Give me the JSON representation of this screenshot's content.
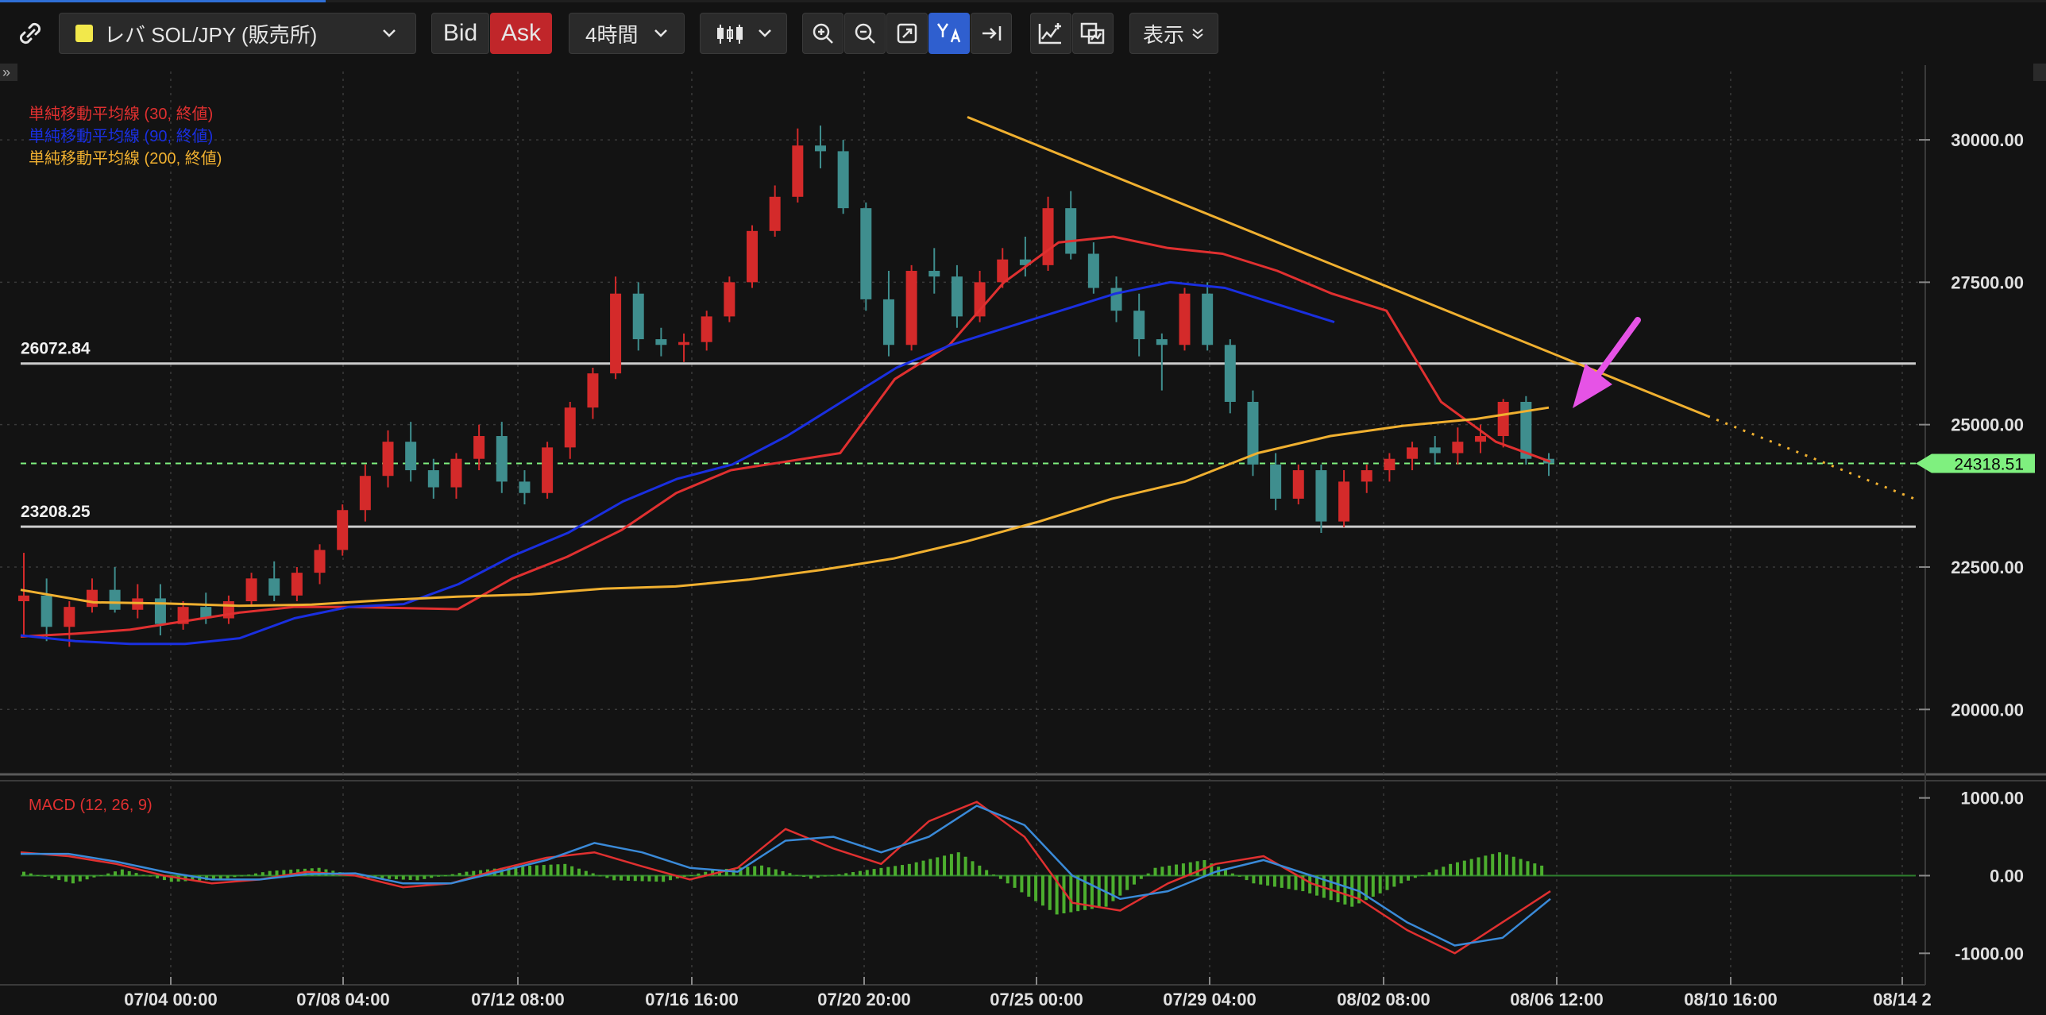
{
  "toolbar": {
    "link_icon": "link-icon",
    "symbol": "レバ SOL/JPY (販売所)",
    "bid_label": "Bid",
    "ask_label": "Ask",
    "timeframe": "4時間",
    "display_label": "表示",
    "colors": {
      "symbol_dot": "#f2e84b",
      "ask": "#c0262a",
      "active": "#2f5fcf"
    }
  },
  "chart_data": [
    {
      "type": "line",
      "subtype": "candlestick",
      "title": "",
      "legend_placement": "top-left",
      "series": [
        {
          "name": "単純移動平均線 (30, 終値)",
          "color": "#e03030",
          "values": [
            21280,
            21330,
            21400,
            21550,
            21700,
            21800,
            21800,
            21780,
            21760,
            22300,
            22680,
            23150,
            23800,
            24200,
            24350,
            24500,
            25800,
            26400,
            27500,
            28200,
            28300,
            28100,
            28000,
            27700,
            27300,
            27000,
            25400,
            24700,
            24350
          ]
        },
        {
          "name": "単純移動平均線 (90, 終値)",
          "color": "#1a2fe0",
          "values": [
            21300,
            21200,
            21150,
            21150,
            21250,
            21600,
            21800,
            21850,
            22200,
            22700,
            23100,
            23650,
            24050,
            24300,
            24800,
            25400,
            26000,
            26400,
            26700,
            27000,
            27300,
            27500,
            27400,
            27100,
            26800
          ]
        },
        {
          "name": "単純移動平均線 (200, 終値)",
          "color": "#f0b030",
          "values": [
            22100,
            21880,
            21860,
            21820,
            21840,
            21920,
            21980,
            22020,
            22120,
            22160,
            22280,
            22450,
            22650,
            22950,
            23300,
            23700,
            24000,
            24500,
            24800,
            24980,
            25100,
            25300
          ]
        }
      ],
      "candles_sample": [
        [
          21900,
          22750,
          21300,
          22000
        ],
        [
          22000,
          22300,
          21200,
          21450
        ],
        [
          21450,
          21900,
          21100,
          21800
        ],
        [
          21800,
          22300,
          21700,
          22100
        ],
        [
          22100,
          22500,
          21700,
          21750
        ],
        [
          21750,
          22200,
          21600,
          21950
        ],
        [
          21950,
          22200,
          21300,
          21500
        ],
        [
          21500,
          21900,
          21400,
          21800
        ],
        [
          21800,
          22050,
          21500,
          21600
        ],
        [
          21600,
          22000,
          21500,
          21900
        ],
        [
          21900,
          22400,
          21800,
          22300
        ],
        [
          22300,
          22600,
          21900,
          22000
        ],
        [
          22000,
          22500,
          21900,
          22400
        ],
        [
          22400,
          22900,
          22200,
          22800
        ],
        [
          22800,
          23600,
          22700,
          23500
        ],
        [
          23500,
          24300,
          23300,
          24100
        ],
        [
          24100,
          24900,
          23900,
          24700
        ],
        [
          24700,
          25050,
          24000,
          24200
        ],
        [
          24200,
          24400,
          23700,
          23900
        ],
        [
          23900,
          24500,
          23700,
          24400
        ],
        [
          24400,
          25000,
          24200,
          24800
        ],
        [
          24800,
          25050,
          23800,
          24000
        ],
        [
          24000,
          24200,
          23600,
          23800
        ],
        [
          23800,
          24700,
          23700,
          24600
        ],
        [
          24600,
          25400,
          24400,
          25300
        ],
        [
          25300,
          26000,
          25100,
          25900
        ],
        [
          25900,
          27600,
          25800,
          27300
        ],
        [
          27300,
          27500,
          26300,
          26500
        ],
        [
          26500,
          26700,
          26200,
          26400
        ],
        [
          26400,
          26600,
          26100,
          26450
        ],
        [
          26450,
          27000,
          26300,
          26900
        ],
        [
          26900,
          27600,
          26800,
          27500
        ],
        [
          27500,
          28500,
          27400,
          28400
        ],
        [
          28400,
          29200,
          28300,
          29000
        ],
        [
          29000,
          30200,
          28900,
          29900
        ],
        [
          29900,
          30250,
          29500,
          29800
        ],
        [
          29800,
          30000,
          28700,
          28800
        ],
        [
          28800,
          28900,
          27000,
          27200
        ],
        [
          27200,
          27700,
          26200,
          26400
        ],
        [
          26400,
          27800,
          26300,
          27700
        ],
        [
          27700,
          28100,
          27300,
          27600
        ],
        [
          27600,
          27800,
          26700,
          26900
        ],
        [
          26900,
          27700,
          26800,
          27500
        ],
        [
          27500,
          28100,
          27400,
          27900
        ],
        [
          27900,
          28300,
          27600,
          27800
        ],
        [
          27800,
          29000,
          27700,
          28800
        ],
        [
          28800,
          29100,
          27900,
          28000
        ],
        [
          28000,
          28200,
          27300,
          27400
        ],
        [
          27400,
          27600,
          26800,
          27000
        ],
        [
          27000,
          27300,
          26200,
          26500
        ],
        [
          26500,
          26600,
          25600,
          26400
        ],
        [
          26400,
          27400,
          26300,
          27300
        ],
        [
          27300,
          27500,
          26300,
          26400
        ],
        [
          26400,
          26500,
          25200,
          25400
        ],
        [
          25400,
          25600,
          24100,
          24300
        ],
        [
          24300,
          24500,
          23500,
          23700
        ],
        [
          23700,
          24300,
          23600,
          24200
        ],
        [
          24200,
          24300,
          23100,
          23300
        ],
        [
          23300,
          24200,
          23200,
          24000
        ],
        [
          24000,
          24300,
          23800,
          24200
        ],
        [
          24200,
          24500,
          24000,
          24400
        ],
        [
          24400,
          24700,
          24200,
          24600
        ],
        [
          24600,
          24800,
          24300,
          24500
        ],
        [
          24500,
          24950,
          24300,
          24700
        ],
        [
          24700,
          25000,
          24500,
          24800
        ],
        [
          24800,
          25450,
          24600,
          25400
        ],
        [
          25400,
          25500,
          24300,
          24400
        ],
        [
          24400,
          24500,
          24100,
          24318.51
        ]
      ],
      "horizontal_lines": [
        {
          "label": "26072.84",
          "value": 26072.84,
          "color": "#cccccc"
        },
        {
          "label": "23208.25",
          "value": 23208.25,
          "color": "#cccccc"
        },
        {
          "label": "24318.51",
          "value": 24318.51,
          "color": "#7ff07f",
          "dashed": true
        }
      ],
      "trendline": {
        "from": [
          "07/22",
          30400
        ],
        "to": [
          "08/14",
          23800
        ],
        "color": "#f0b030"
      },
      "annotation": {
        "type": "arrow",
        "color": "#e653e6",
        "points_to": "trendline break near 25300"
      },
      "y_ticks": [
        "30000.00",
        "27500.00",
        "25000.00",
        "22500.00",
        "20000.00"
      ],
      "ylim": [
        19000,
        31200
      ],
      "grid": true
    },
    {
      "type": "bar",
      "title": "MACD (12, 26, 9)",
      "series": [
        {
          "name": "",
          "color": "#e03030",
          "values": [
            300,
            250,
            150,
            0,
            -100,
            -50,
            50,
            0,
            -150,
            -100,
            80,
            230,
            300,
            120,
            -50,
            100,
            600,
            350,
            150,
            700,
            950,
            500,
            -350,
            -450,
            -100,
            150,
            250,
            -100,
            -300,
            -700,
            -1000,
            -600,
            -200
          ]
        },
        {
          "name": "",
          "color": "#3a8ad8",
          "values": [
            280,
            280,
            180,
            50,
            -50,
            -50,
            20,
            30,
            -100,
            -100,
            50,
            200,
            420,
            300,
            100,
            50,
            450,
            500,
            300,
            500,
            900,
            650,
            0,
            -300,
            -200,
            50,
            200,
            0,
            -200,
            -600,
            -900,
            -800,
            -300
          ]
        },
        {
          "name": "histogram",
          "color": "#4cae2e",
          "values": [
            50,
            -100,
            80,
            -80,
            -50,
            60,
            100,
            -30,
            -60,
            50,
            120,
            150,
            -60,
            -80,
            70,
            130,
            -40,
            60,
            150,
            300,
            -100,
            -500,
            -400,
            100,
            200,
            -100,
            -200,
            -400,
            -100,
            150,
            300,
            100
          ]
        }
      ],
      "y_ticks": [
        "1000.00",
        "0.00",
        "-1000.00"
      ],
      "ylim": [
        -1150,
        1150
      ]
    }
  ],
  "x_labels": [
    "07/04 00:00",
    "07/08 04:00",
    "07/12 08:00",
    "07/16 16:00",
    "07/20 20:00",
    "07/25 00:00",
    "07/29 04:00",
    "08/02 08:00",
    "08/06 12:00",
    "08/10 16:00",
    "08/14 2"
  ],
  "price_tag": "24318.51"
}
